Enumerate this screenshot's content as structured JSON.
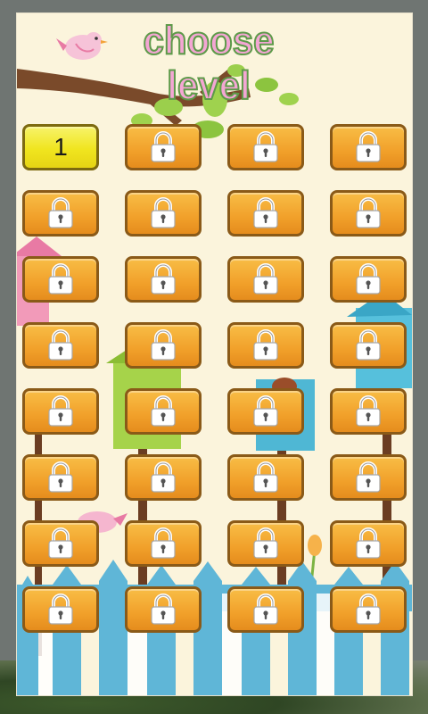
{
  "screen": {
    "title": "choose level"
  },
  "colors": {
    "title_fill": "#f4a6d4",
    "title_outline": "#5e9a4a",
    "locked_button": "#f1a02a",
    "unlocked_button": "#f0e51f",
    "panel_background": "#fbf4dc"
  },
  "levels": [
    {
      "number": "1",
      "locked": false
    },
    {
      "number": "",
      "locked": true
    },
    {
      "number": "",
      "locked": true
    },
    {
      "number": "",
      "locked": true
    },
    {
      "number": "",
      "locked": true
    },
    {
      "number": "",
      "locked": true
    },
    {
      "number": "",
      "locked": true
    },
    {
      "number": "",
      "locked": true
    },
    {
      "number": "",
      "locked": true
    },
    {
      "number": "",
      "locked": true
    },
    {
      "number": "",
      "locked": true
    },
    {
      "number": "",
      "locked": true
    },
    {
      "number": "",
      "locked": true
    },
    {
      "number": "",
      "locked": true
    },
    {
      "number": "",
      "locked": true
    },
    {
      "number": "",
      "locked": true
    },
    {
      "number": "",
      "locked": true
    },
    {
      "number": "",
      "locked": true
    },
    {
      "number": "",
      "locked": true
    },
    {
      "number": "",
      "locked": true
    },
    {
      "number": "",
      "locked": true
    },
    {
      "number": "",
      "locked": true
    },
    {
      "number": "",
      "locked": true
    },
    {
      "number": "",
      "locked": true
    },
    {
      "number": "",
      "locked": true
    },
    {
      "number": "",
      "locked": true
    },
    {
      "number": "",
      "locked": true
    },
    {
      "number": "",
      "locked": true
    },
    {
      "number": "",
      "locked": true
    },
    {
      "number": "",
      "locked": true
    },
    {
      "number": "",
      "locked": true
    },
    {
      "number": "",
      "locked": true
    }
  ],
  "icons": {
    "locked": "padlock-icon",
    "decoration": [
      "bird-icon",
      "tree-branch",
      "birdhouse-icon",
      "fence"
    ]
  }
}
